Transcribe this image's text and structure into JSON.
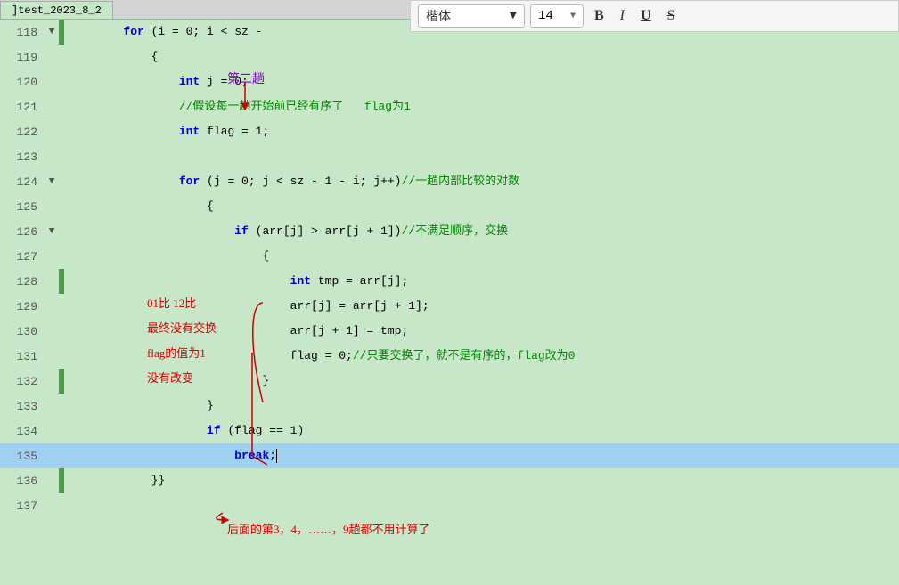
{
  "tab": {
    "label": "]test_2023_8_2"
  },
  "toolbar": {
    "font_label": "楷体",
    "font_size": "14",
    "bold_label": "B",
    "italic_label": "I",
    "underline_label": "U",
    "strikethrough_label": "S"
  },
  "lines": [
    {
      "num": "118",
      "fold": "▼",
      "bar": true,
      "indent": 2,
      "content": "for (i = 0; i < sz - ",
      "highlight": false
    },
    {
      "num": "119",
      "fold": "",
      "bar": false,
      "indent": 3,
      "content": "{",
      "highlight": false
    },
    {
      "num": "120",
      "fold": "",
      "bar": false,
      "indent": 4,
      "content": "int j = 0;",
      "highlight": false
    },
    {
      "num": "121",
      "fold": "",
      "bar": false,
      "indent": 4,
      "content": "//假设每一趟开始前已经有序了   flag为1",
      "highlight": false
    },
    {
      "num": "122",
      "fold": "",
      "bar": false,
      "indent": 4,
      "content": "int flag = 1;",
      "highlight": false
    },
    {
      "num": "123",
      "fold": "",
      "bar": false,
      "indent": 4,
      "content": "",
      "highlight": false
    },
    {
      "num": "124",
      "fold": "▼",
      "bar": false,
      "indent": 4,
      "content": "for (j = 0; j < sz - 1 - i; j++)//一趟内部比较的对数",
      "highlight": false
    },
    {
      "num": "125",
      "fold": "",
      "bar": false,
      "indent": 5,
      "content": "{",
      "highlight": false
    },
    {
      "num": "126",
      "fold": "▼",
      "bar": false,
      "indent": 5,
      "content": "if (arr[j] > arr[j + 1])//不满足顺序，交换",
      "highlight": false
    },
    {
      "num": "127",
      "fold": "",
      "bar": false,
      "indent": 6,
      "content": "{",
      "highlight": false
    },
    {
      "num": "128",
      "fold": "",
      "bar": true,
      "indent": 7,
      "content": "int tmp = arr[j];",
      "highlight": false
    },
    {
      "num": "129",
      "fold": "",
      "bar": false,
      "indent": 7,
      "content": "arr[j] = arr[j + 1];",
      "highlight": false
    },
    {
      "num": "130",
      "fold": "",
      "bar": false,
      "indent": 7,
      "content": "arr[j + 1] = tmp;",
      "highlight": false
    },
    {
      "num": "131",
      "fold": "",
      "bar": false,
      "indent": 7,
      "content": "flag = 0;//只要交换了，就不是有序的，flag改为0",
      "highlight": false
    },
    {
      "num": "132",
      "fold": "",
      "bar": false,
      "indent": 6,
      "content": "}",
      "highlight": false
    },
    {
      "num": "133",
      "fold": "",
      "bar": false,
      "indent": 5,
      "content": "}",
      "highlight": false
    },
    {
      "num": "134",
      "fold": "",
      "bar": false,
      "indent": 4,
      "content": "if (flag == 1)",
      "highlight": false
    },
    {
      "num": "135",
      "fold": "",
      "bar": false,
      "indent": 5,
      "content": "break;",
      "highlight": true
    },
    {
      "num": "136",
      "fold": "",
      "bar": true,
      "indent": 3,
      "content": "}}",
      "highlight": false
    },
    {
      "num": "137",
      "fold": "",
      "bar": false,
      "indent": 0,
      "content": "",
      "highlight": false
    }
  ],
  "annotations": [
    {
      "text": "第二趟",
      "color": "#8800cc"
    },
    {
      "text": "01比  12比"
    },
    {
      "text": "最终没有交换"
    },
    {
      "text": "flag的值为1"
    },
    {
      "text": "没有改变"
    },
    {
      "text": "后面的第3，4，……，9趟都不用计算了"
    }
  ]
}
